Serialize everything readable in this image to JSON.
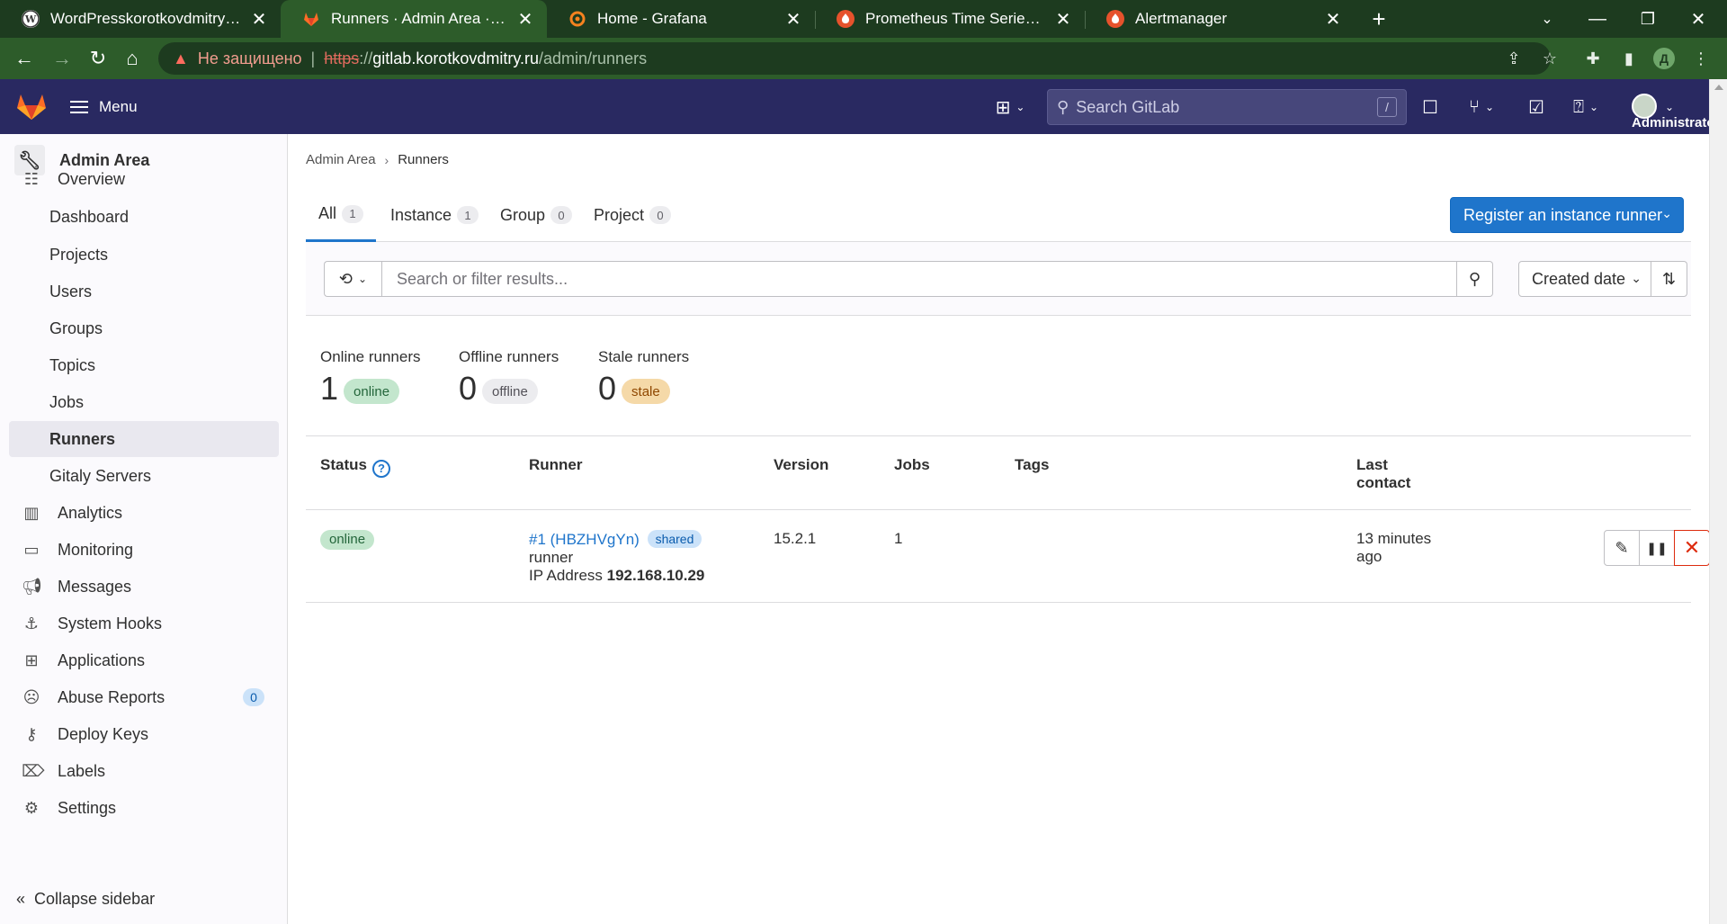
{
  "browser": {
    "tabs": [
      {
        "title": "WordPresskorotkovdmitry — Ещ",
        "active": false
      },
      {
        "title": "Runners · Admin Area · GitLab",
        "active": true
      },
      {
        "title": "Home - Grafana",
        "active": false
      },
      {
        "title": "Prometheus Time Series Collectic",
        "active": false
      },
      {
        "title": "Alertmanager",
        "active": false
      }
    ],
    "insecure_label": "Не защищено",
    "url_scheme": "https",
    "url_sep": "://",
    "url_host": "gitlab.korotkovdmitry.ru",
    "url_path": "/admin/runners",
    "profile_letter": "Д"
  },
  "header": {
    "menu_label": "Menu",
    "search_placeholder": "Search GitLab",
    "search_shortcut": "/",
    "user_name": "Administrator"
  },
  "sidebar": {
    "context_title": "Admin Area",
    "items": [
      {
        "label": "Overview",
        "icon": "overview-icon"
      },
      {
        "label": "Dashboard"
      },
      {
        "label": "Projects"
      },
      {
        "label": "Users"
      },
      {
        "label": "Groups"
      },
      {
        "label": "Topics"
      },
      {
        "label": "Jobs"
      },
      {
        "label": "Runners",
        "active": true
      },
      {
        "label": "Gitaly Servers"
      },
      {
        "label": "Analytics",
        "icon": "analytics-icon"
      },
      {
        "label": "Monitoring",
        "icon": "monitoring-icon"
      },
      {
        "label": "Messages",
        "icon": "messages-icon"
      },
      {
        "label": "System Hooks",
        "icon": "anchor-icon"
      },
      {
        "label": "Applications",
        "icon": "applications-icon"
      },
      {
        "label": "Abuse Reports",
        "icon": "abuse-icon",
        "badge": "0"
      },
      {
        "label": "Deploy Keys",
        "icon": "key-icon"
      },
      {
        "label": "Labels",
        "icon": "label-icon"
      },
      {
        "label": "Settings",
        "icon": "settings-icon"
      }
    ],
    "collapse_label": "Collapse sidebar"
  },
  "breadcrumb": {
    "parent": "Admin Area",
    "current": "Runners"
  },
  "tabs": [
    {
      "label": "All",
      "count": "1"
    },
    {
      "label": "Instance",
      "count": "1"
    },
    {
      "label": "Group",
      "count": "0"
    },
    {
      "label": "Project",
      "count": "0"
    }
  ],
  "register_button": "Register an instance runner",
  "filter": {
    "placeholder": "Search or filter results...",
    "sort_label": "Created date"
  },
  "stats": [
    {
      "label": "Online runners",
      "count": "1",
      "badge": "online"
    },
    {
      "label": "Offline runners",
      "count": "0",
      "badge": "offline"
    },
    {
      "label": "Stale runners",
      "count": "0",
      "badge": "stale"
    }
  ],
  "table": {
    "headers": {
      "status": "Status",
      "runner": "Runner",
      "version": "Version",
      "jobs": "Jobs",
      "tags": "Tags",
      "last_contact_1": "Last",
      "last_contact_2": "contact"
    },
    "rows": [
      {
        "status": "online",
        "runner_id": "#1 (HBZHVgYn)",
        "runner_type": "shared",
        "description": "runner",
        "ip_label": "IP Address",
        "ip": "192.168.10.29",
        "version": "15.2.1",
        "jobs": "1",
        "tags": "",
        "last_contact_1": "13 minutes",
        "last_contact_2": "ago"
      }
    ]
  },
  "colors": {
    "header_bg": "#292961",
    "primary": "#1f75cb",
    "online": "#24663b",
    "stale": "#8f4700",
    "danger": "#dd2b0e"
  }
}
